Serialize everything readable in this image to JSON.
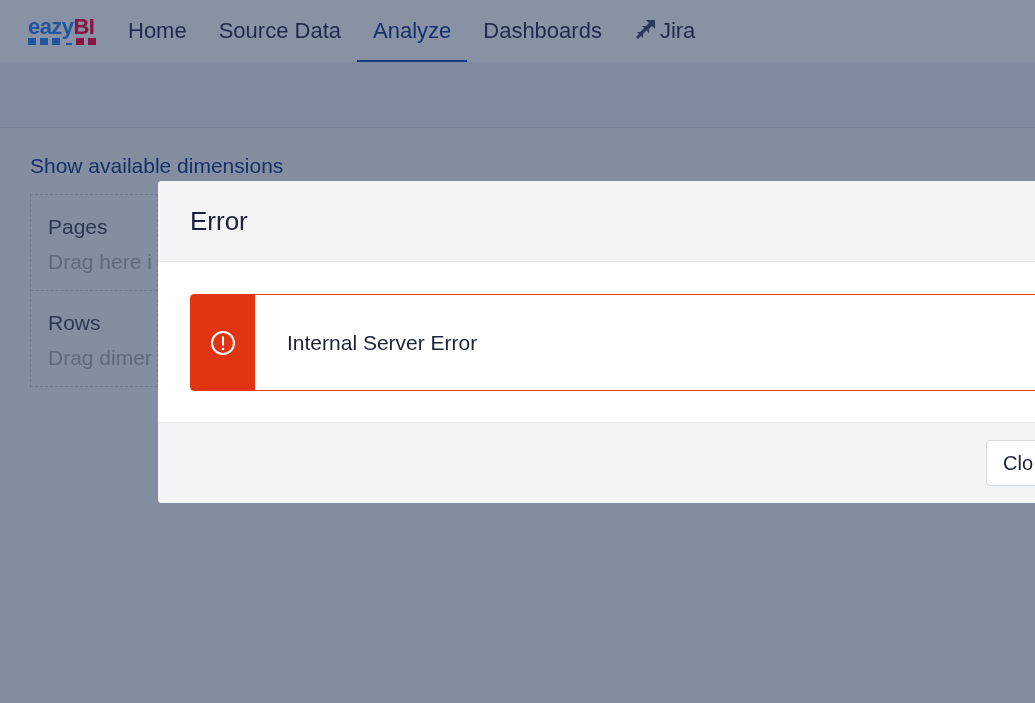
{
  "logo": {
    "first": "eazy",
    "second": "BI"
  },
  "nav": [
    {
      "label": "Home",
      "selected": false,
      "kind": "page"
    },
    {
      "label": "Source Data",
      "selected": false,
      "kind": "page"
    },
    {
      "label": "Analyze",
      "selected": true,
      "kind": "page"
    },
    {
      "label": "Dashboards",
      "selected": false,
      "kind": "page"
    },
    {
      "label": "Jira",
      "selected": false,
      "kind": "app"
    }
  ],
  "dimensions_link": "Show available dimensions",
  "drop_areas": [
    {
      "title": "Pages",
      "hint": "Drag here i"
    },
    {
      "title": "Rows",
      "hint": "Drag dimer"
    }
  ],
  "dialog": {
    "title": "Error",
    "alert": {
      "color": "#e03510",
      "message": "Internal Server Error"
    },
    "buttons": [
      "Clo"
    ]
  }
}
